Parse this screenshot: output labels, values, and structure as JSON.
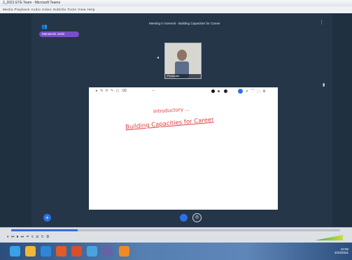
{
  "window": {
    "title": "2_2021 ETE Team - Microsoft Teams",
    "menu": "Media  Playback  Audio  Video  Subtitle  Tools  View  Help"
  },
  "meeting": {
    "title": "Meeting in General · Building Capacities for Career",
    "participant_pill": "Manasvini Joshi",
    "participant_name": "Presenter",
    "more_label": "⋮"
  },
  "whiteboard": {
    "line1": "Introductory ...",
    "line2": "Building Capacities for Career"
  },
  "player": {
    "controls": "⏸  ⏮ ⏹ ⏭  ▭ ≡ ⇄ ↻  ⚙"
  },
  "taskbar": {
    "time": "10:05",
    "date": "3/10/2021"
  },
  "colors": {
    "ink": "#e04040",
    "accent": "#2e6fe6",
    "pill": "#7a4fc9"
  }
}
